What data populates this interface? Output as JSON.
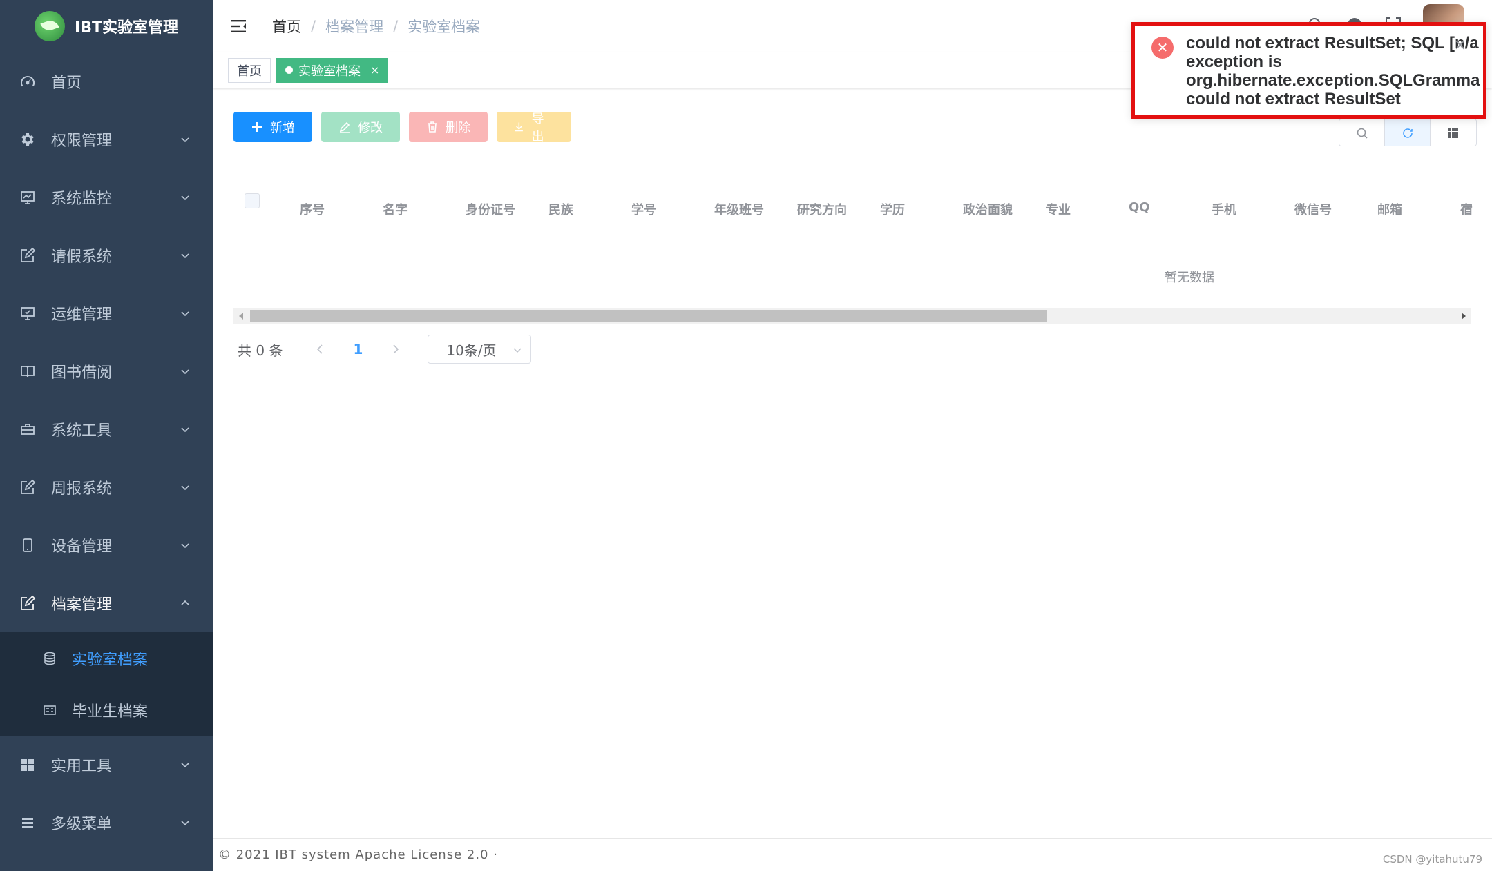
{
  "app": {
    "logo_text": "IBT实验室管理"
  },
  "sidebar": {
    "items": [
      {
        "label": "首页",
        "icon": "dashboard-icon"
      },
      {
        "label": "权限管理",
        "icon": "gear-icon"
      },
      {
        "label": "系统监控",
        "icon": "monitor-icon"
      },
      {
        "label": "请假系统",
        "icon": "edit-icon"
      },
      {
        "label": "运维管理",
        "icon": "server-icon"
      },
      {
        "label": "图书借阅",
        "icon": "book-icon"
      },
      {
        "label": "系统工具",
        "icon": "toolbox-icon"
      },
      {
        "label": "周报系统",
        "icon": "edit-icon"
      },
      {
        "label": "设备管理",
        "icon": "phone-icon"
      },
      {
        "label": "档案管理",
        "icon": "edit-icon"
      }
    ],
    "submenu": [
      {
        "label": "实验室档案",
        "icon": "database-icon",
        "active": true
      },
      {
        "label": "毕业生档案",
        "icon": "form-icon"
      }
    ],
    "bottom_items": [
      {
        "label": "实用工具",
        "icon": "grid-icon"
      },
      {
        "label": "多级菜单",
        "icon": "list-icon"
      }
    ]
  },
  "breadcrumb": [
    "首页",
    "档案管理",
    "实验室档案"
  ],
  "tags": [
    {
      "label": "首页",
      "active": false
    },
    {
      "label": "实验室档案",
      "active": true,
      "close": "×"
    }
  ],
  "toolbar": {
    "add": "新增",
    "edit": "修改",
    "delete": "删除",
    "export": "导出"
  },
  "table": {
    "columns": [
      "序号",
      "名字",
      "身份证号",
      "民族",
      "学号",
      "年级班号",
      "研究方向",
      "学历",
      "政治面貌",
      "专业",
      "QQ",
      "手机",
      "微信号",
      "邮箱",
      "宿"
    ],
    "empty_text": "暂无数据"
  },
  "pagination": {
    "total": "共 0 条",
    "current": "1",
    "page_size": "10条/页"
  },
  "footer": {
    "copyright": "© 2021 IBT system Apache License 2.0 ·",
    "watermark": "CSDN @yitahutu79"
  },
  "notification": {
    "type": "error",
    "lines": [
      "could not extract ResultSet; SQL [n/a",
      "exception is",
      "org.hibernate.exception.SQLGramma",
      "could not extract ResultSet"
    ],
    "close": "×"
  },
  "colors": {
    "sidebar_bg": "#304156",
    "submenu_bg": "#1f2d3d",
    "primary": "#1890ff",
    "tag_active": "#42b983",
    "error_border": "#e31010"
  }
}
